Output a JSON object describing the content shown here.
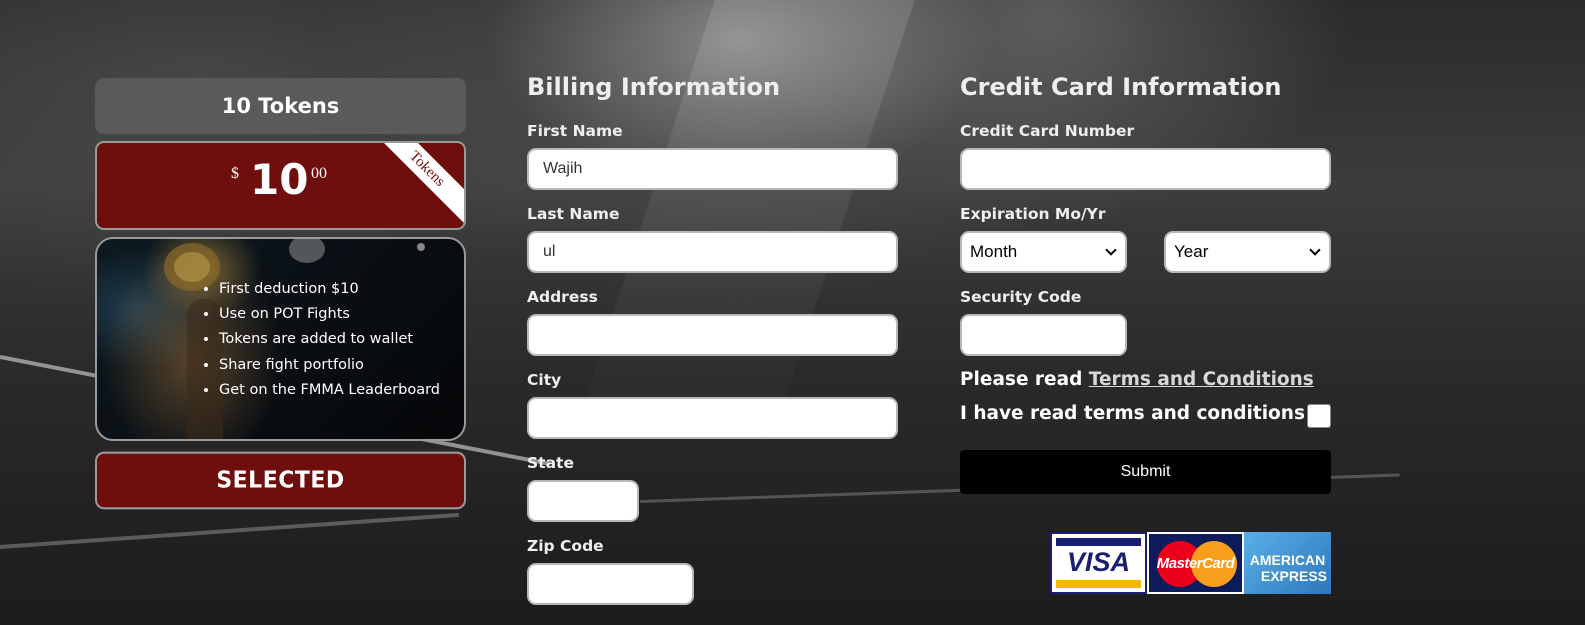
{
  "plan": {
    "title": "10 Tokens",
    "currency_symbol": "$",
    "price_whole": "10",
    "price_cents": "00",
    "ribbon_label": "Tokens",
    "features": [
      "First deduction $10",
      "Use on POT Fights",
      "Tokens are added to wallet",
      "Share fight portfolio",
      "Get on the FMMA Leaderboard"
    ],
    "select_label": "SELECTED"
  },
  "billing": {
    "title": "Billing Information",
    "first_name_label": "First Name",
    "first_name_value": "Wajih",
    "last_name_label": "Last Name",
    "last_name_value": "ul",
    "address_label": "Address",
    "address_value": "",
    "city_label": "City",
    "city_value": "",
    "state_label": "State",
    "state_value": "",
    "zip_label": "Zip Code",
    "zip_value": ""
  },
  "card": {
    "title": "Credit Card Information",
    "number_label": "Credit Card Number",
    "number_value": "",
    "expiration_label": "Expiration Mo/Yr",
    "month_selected": "Month",
    "year_selected": "Year",
    "security_label": "Security Code",
    "security_value": "",
    "terms_prefix": "Please read",
    "terms_link": "Terms and Conditions",
    "agree_label": "I have read terms and conditions",
    "agree_checked": false,
    "submit_label": "Submit"
  },
  "card_logos": {
    "visa": "VISA",
    "mastercard": "MasterCard",
    "amex_line1": "AMERICAN",
    "amex_line2": "EXPRESS"
  },
  "colors": {
    "accent_red": "#6e0f0d",
    "header_gray": "#5a5a5a",
    "submit_black": "#000000"
  }
}
